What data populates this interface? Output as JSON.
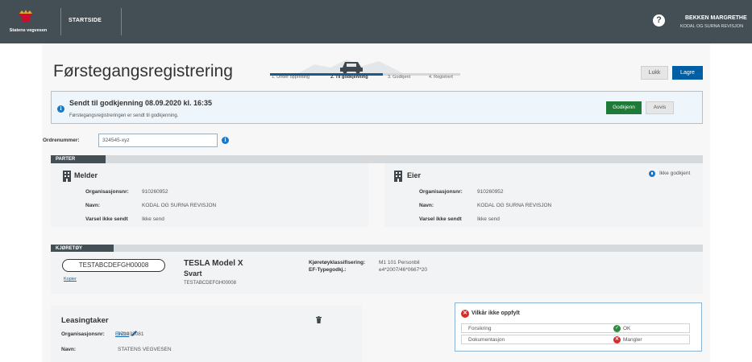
{
  "topbar": {
    "logo_text": "Statens vegvesen",
    "startside": "STARTSIDE",
    "user_name": "BEKKEN MARGRETHE",
    "user_org": "KODAL OG SURNA REVISJON"
  },
  "header": {
    "title": "Førstegangsregistrering",
    "steps": [
      "1. Under oppretting",
      "2. Til godkjenning",
      "3. Godkjent",
      "4. Registrert"
    ],
    "active_step": 2,
    "close_label": "Lukk",
    "save_label": "Lagre"
  },
  "alert": {
    "title": "Sendt til godkjenning 08.09.2020 kl. 16:35",
    "body": "Førstegangsregistreringen er sendt til godkjenning.",
    "approve_label": "Godkjenn",
    "reject_label": "Avvis"
  },
  "ordre": {
    "label": "Ordrenummer:",
    "value": "324545-xyz"
  },
  "parter": {
    "section_label": "PARTER",
    "melder": {
      "title": "Melder",
      "org_label": "Organisasjonsnr:",
      "org_value": "910260952",
      "name_label": "Navn:",
      "name_value": "KODAL OG SURNA REVISJON",
      "varsel_label": "Varsel ikke sendt",
      "varsel_value": "Ikke send"
    },
    "eier": {
      "title": "Eier",
      "status": "Ikke godkjent",
      "org_label": "Organisasjonsnr:",
      "org_value": "910260952",
      "name_label": "Navn:",
      "name_value": "KODAL OG SURNA REVISJON",
      "varsel_label": "Varsel ikke sendt",
      "varsel_value": "Ikke send"
    }
  },
  "kjoretoy": {
    "section_label": "KJØRETØY",
    "reg_no": "TESTABCDEFGH00008",
    "copy_label": "Kopier",
    "model": "TESLA Model X",
    "color": "Svart",
    "vin": "TESTABCDEFGH00008",
    "class_label": "Kjøretøyklassifisering:",
    "class_value": "M1 101 Personbil",
    "ef_label": "EF-Typegodkj.:",
    "ef_value": "e4*2007/46*0667*20"
  },
  "leasing": {
    "title": "Leasingtaker",
    "org_label": "Organisasjonsnr:",
    "org_value": "971032081",
    "edit_label": "Endre",
    "name_label": "Navn:",
    "name_value": "STATENS VEGVESEN"
  },
  "vilkar": {
    "title": "Vilkår ikke oppfylt",
    "rows": [
      {
        "label": "Forsikring",
        "status": "OK"
      },
      {
        "label": "Dokumentasjon",
        "status": "Mangler"
      }
    ]
  },
  "colors": {
    "topbar": "#444f55",
    "primary": "#005ea5",
    "approve": "#1e7a36",
    "error": "#d42b2b",
    "ok": "#2e8b3d",
    "info": "#1b78c6"
  }
}
